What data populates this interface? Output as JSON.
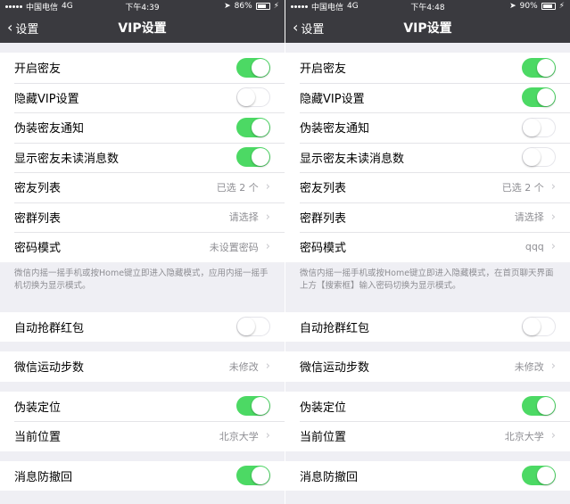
{
  "left": {
    "status": {
      "carrier": "中国电信",
      "network": "4G",
      "time": "下午4:39",
      "battery": "86%",
      "battery_level": 0.86
    },
    "nav": {
      "back_label": "设置",
      "title": "VIP设置"
    },
    "group1": [
      {
        "label": "开启密友",
        "toggle": "on"
      },
      {
        "label": "隐藏VIP设置",
        "toggle": "off"
      },
      {
        "label": "伪装密友通知",
        "toggle": "on"
      },
      {
        "label": "显示密友未读消息数",
        "toggle": "on"
      },
      {
        "label": "密友列表",
        "value": "已选 2 个"
      },
      {
        "label": "密群列表",
        "value": "请选择"
      },
      {
        "label": "密码模式",
        "value": "未设置密码"
      }
    ],
    "note": "微信内摇一摇手机或按Home键立即进入隐藏模式，应用内摇一摇手机切换为显示模式。",
    "red_packet": {
      "label": "自动抢群红包",
      "toggle": "off"
    },
    "steps": {
      "label": "微信运动步数",
      "value": "未修改"
    },
    "location": [
      {
        "label": "伪装定位",
        "toggle": "on"
      },
      {
        "label": "当前位置",
        "value": "北京大学"
      }
    ],
    "recall": {
      "label": "消息防撤回",
      "toggle": "on"
    }
  },
  "right": {
    "status": {
      "carrier": "中国电信",
      "network": "4G",
      "time": "下午4:48",
      "battery": "90%",
      "battery_level": 0.9
    },
    "nav": {
      "back_label": "设置",
      "title": "VIP设置"
    },
    "group1": [
      {
        "label": "开启密友",
        "toggle": "on"
      },
      {
        "label": "隐藏VIP设置",
        "toggle": "on"
      },
      {
        "label": "伪装密友通知",
        "toggle": "off"
      },
      {
        "label": "显示密友未读消息数",
        "toggle": "off"
      },
      {
        "label": "密友列表",
        "value": "已选 2 个"
      },
      {
        "label": "密群列表",
        "value": "请选择"
      },
      {
        "label": "密码模式",
        "value": "qqq"
      }
    ],
    "note": "微信内摇一摇手机或按Home键立即进入隐藏模式，在首页聊天界面上方【搜索框】输入密码切换为显示模式。",
    "red_packet": {
      "label": "自动抢群红包",
      "toggle": "off"
    },
    "steps": {
      "label": "微信运动步数",
      "value": "未修改"
    },
    "location": [
      {
        "label": "伪装定位",
        "toggle": "on"
      },
      {
        "label": "当前位置",
        "value": "北京大学"
      }
    ],
    "recall": {
      "label": "消息防撤回",
      "toggle": "on"
    }
  },
  "colors": {
    "toggle_on": "#4cd964",
    "navbar": "#3a3a3f",
    "background": "#efeff4"
  },
  "icons": {
    "back": "chevron-left-icon",
    "disclosure": "chevron-right-icon",
    "location": "location-arrow-icon",
    "battery": "battery-icon",
    "charging": "charging-bolt-icon"
  }
}
